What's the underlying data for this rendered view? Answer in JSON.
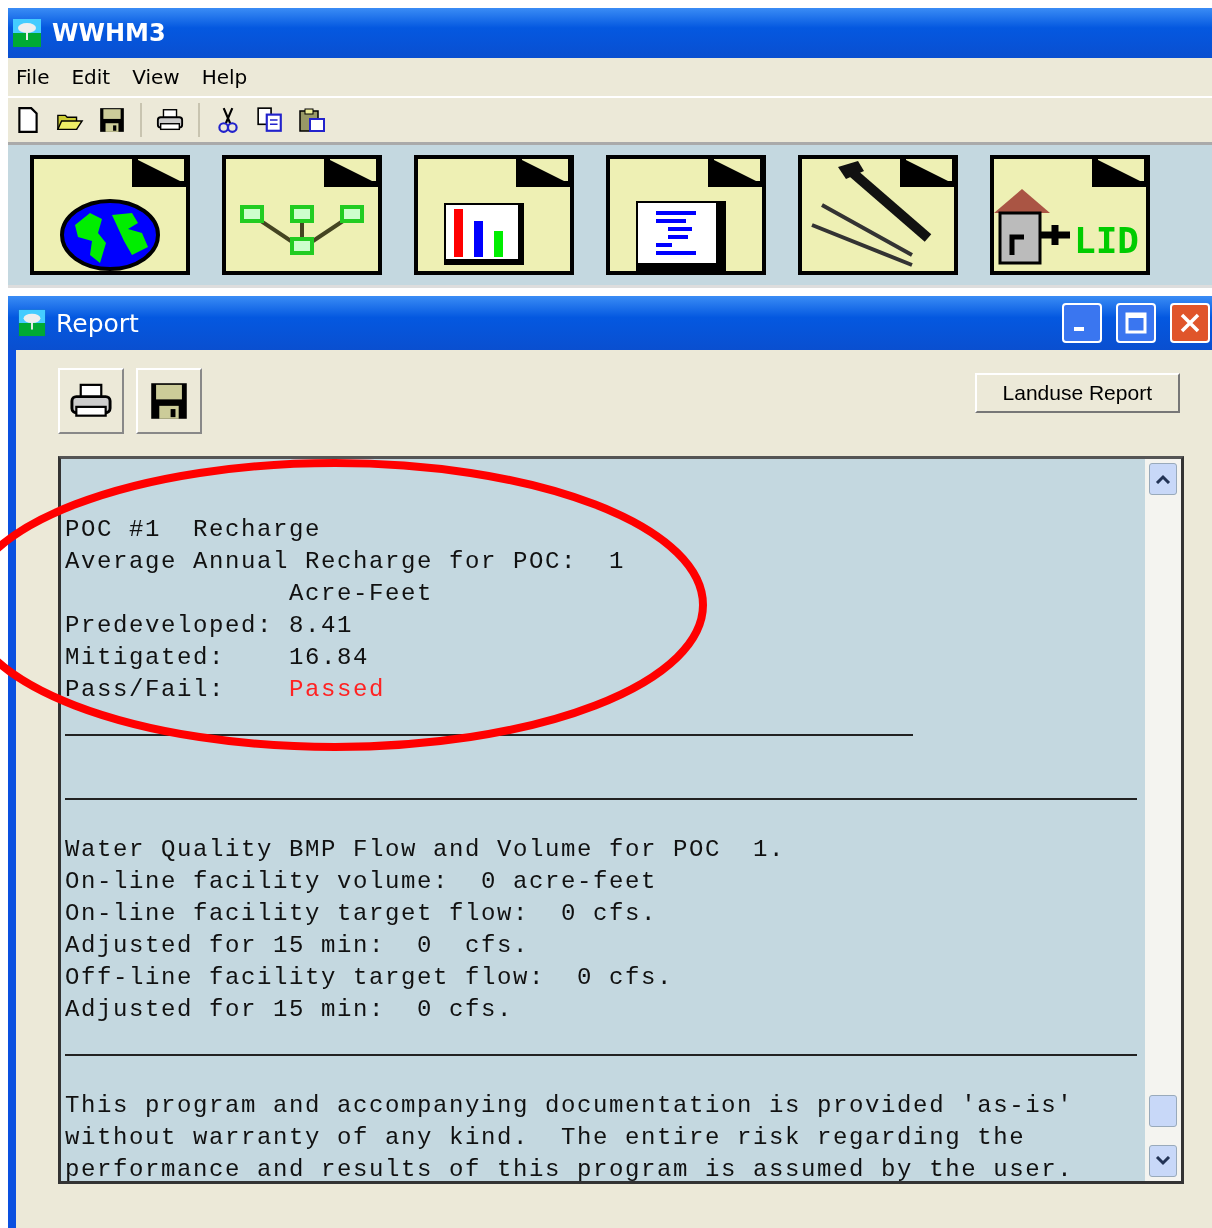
{
  "window": {
    "title": "WWHM3"
  },
  "menu": [
    "File",
    "Edit",
    "View",
    "Help"
  ],
  "tool_buttons": [
    {
      "kind": "globe"
    },
    {
      "kind": "network"
    },
    {
      "kind": "chart"
    },
    {
      "kind": "report"
    },
    {
      "kind": "tools"
    },
    {
      "kind": "lid",
      "label": "LID"
    }
  ],
  "report_window": {
    "title": "Report",
    "landuse_button": "Landuse Report",
    "lines": [
      {
        "kind": "text",
        "text": "POC #1  Recharge"
      },
      {
        "kind": "text",
        "text": "Average Annual Recharge for POC:  1"
      },
      {
        "kind": "text",
        "text": "              Acre-Feet"
      },
      {
        "kind": "text",
        "text": "Predeveloped: 8.41"
      },
      {
        "kind": "text",
        "text": "Mitigated:    16.84"
      },
      {
        "kind": "result",
        "label": "Pass/Fail:    ",
        "value": "Passed"
      },
      {
        "kind": "short_rule"
      },
      {
        "kind": "blank"
      },
      {
        "kind": "rule"
      },
      {
        "kind": "blank"
      },
      {
        "kind": "text",
        "text": "Water Quality BMP Flow and Volume for POC  1."
      },
      {
        "kind": "text",
        "text": "On-line facility volume:  0 acre-feet"
      },
      {
        "kind": "text",
        "text": "On-line facility target flow:  0 cfs."
      },
      {
        "kind": "text",
        "text": "Adjusted for 15 min:  0  cfs."
      },
      {
        "kind": "text",
        "text": "Off-line facility target flow:  0 cfs."
      },
      {
        "kind": "text",
        "text": "Adjusted for 15 min:  0 cfs."
      },
      {
        "kind": "rule"
      },
      {
        "kind": "blank"
      },
      {
        "kind": "text",
        "text": "This program and accompanying documentation is provided 'as-is'"
      },
      {
        "kind": "text",
        "text": "without warranty of any kind.  The entire risk regarding the"
      },
      {
        "kind": "text",
        "text": "performance and results of this program is assumed by the user."
      }
    ]
  }
}
